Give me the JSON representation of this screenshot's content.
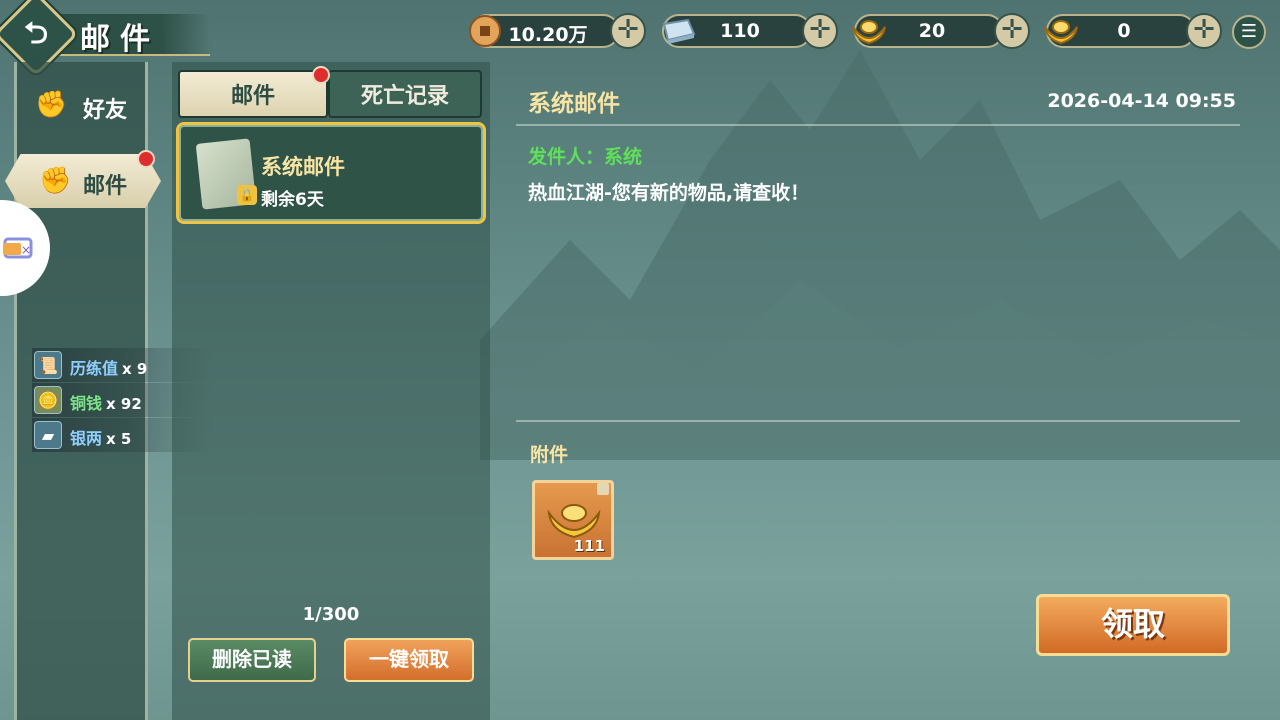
{
  "header": {
    "title": "邮件",
    "currencies": [
      {
        "icon": "copper-coin-icon",
        "value": "10.20万"
      },
      {
        "icon": "silver-ingot-icon",
        "value": "110"
      },
      {
        "icon": "bound-gold-ingot-icon",
        "value": "20"
      },
      {
        "icon": "gold-ingot-icon",
        "value": "0"
      }
    ]
  },
  "nav": {
    "friends": "好友",
    "mail": "邮件"
  },
  "rewards": [
    {
      "name": "历练值",
      "count": "x 9",
      "color": "#8fd0ff"
    },
    {
      "name": "铜钱",
      "count": "x 92",
      "color": "#7de38a"
    },
    {
      "name": "银两",
      "count": "x 5",
      "color": "#8fd0ff"
    }
  ],
  "mail_list": {
    "tabs": [
      "邮件",
      "死亡记录"
    ],
    "items": [
      {
        "title": "系统邮件",
        "remaining": "剩余6天"
      }
    ],
    "count": "1/300",
    "delete_read": "删除已读",
    "claim_all": "一键领取"
  },
  "detail": {
    "title": "系统邮件",
    "date": "2026-04-14 09:55",
    "sender": "发件人：系统",
    "body": "热血江湖-您有新的物品,请查收！",
    "attachments_label": "附件",
    "attachment": {
      "icon": "gold-ingot-icon",
      "count": "111"
    },
    "claim": "领取"
  },
  "colors": {
    "accent_gold": "#f8e5a6",
    "sender_green": "#5fe05a",
    "button_orange": "#d26a26"
  }
}
